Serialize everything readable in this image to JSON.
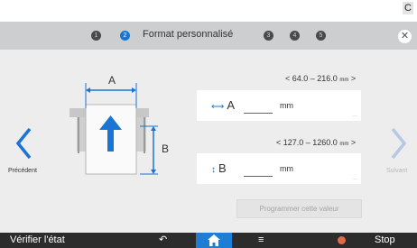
{
  "header": {
    "title": "Format personnalisé",
    "steps": [
      {
        "label": "1",
        "active": false
      },
      {
        "label": "2",
        "active": true
      },
      {
        "label": "3",
        "active": false
      },
      {
        "label": "4",
        "active": false
      },
      {
        "label": "5",
        "active": false
      }
    ]
  },
  "diagram": {
    "label_a": "A",
    "label_b": "B"
  },
  "nav": {
    "prev_label": "Précédent",
    "next_label": "Suivant"
  },
  "field_a": {
    "label": "A",
    "range": "< 64.0 – 216.0",
    "range_unit": "mm",
    "range_close": ">",
    "value": "",
    "unit": "mm"
  },
  "field_b": {
    "label": "B",
    "range": "< 127.0 – 1260.0",
    "range_unit": "mm",
    "range_close": ">",
    "value": "",
    "unit": "mm"
  },
  "program_button": "Programmer cette valeur",
  "bottom": {
    "check_status": "Vérifier l'état",
    "stop": "Stop"
  },
  "colors": {
    "accent": "#1a74d4",
    "header_bg": "#ccced0",
    "bottom_bg": "#2c2c2c",
    "stop": "#e06a4a"
  }
}
